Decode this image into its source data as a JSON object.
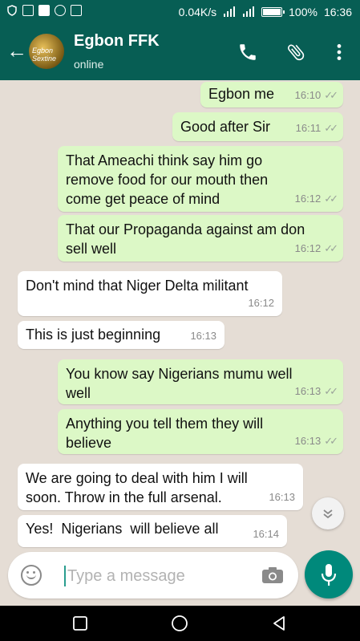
{
  "status_bar": {
    "speed": "0.04K/s",
    "battery": "100%",
    "time": "16:36",
    "icons": [
      "shield-icon",
      "true-badge-icon",
      "facebook-icon",
      "ball-icon",
      "screenshot-icon",
      "signal-icon",
      "4g-signal-icon",
      "battery-icon"
    ]
  },
  "header": {
    "name": "Egbon FFK",
    "status": "online",
    "avatar_text": "Egbon Sextine",
    "icons": [
      "back-arrow-icon",
      "phone-icon",
      "attach-icon",
      "more-vert-icon"
    ]
  },
  "messages": [
    {
      "dir": "out",
      "lines": [
        "Egbon me"
      ],
      "time": "16:10",
      "ticks": true
    },
    {
      "dir": "out",
      "lines": [
        "Good after Sir"
      ],
      "time": "16:11",
      "ticks": true
    },
    {
      "dir": "out",
      "lines": [
        "That Ameachi think say him go",
        "remove food for our mouth then",
        "come get peace of mind"
      ],
      "time": "16:12",
      "ticks": true
    },
    {
      "dir": "out",
      "lines": [
        "That our Propaganda against am don",
        "sell well"
      ],
      "time": "16:12",
      "ticks": true
    },
    {
      "dir": "in",
      "lines": [
        "Don't mind that Niger Delta militant"
      ],
      "time": "16:12"
    },
    {
      "dir": "in",
      "lines": [
        "This is just beginning"
      ],
      "time": "16:13"
    },
    {
      "dir": "out",
      "lines": [
        "You know say Nigerians mumu well",
        "well"
      ],
      "time": "16:13",
      "ticks": true
    },
    {
      "dir": "out",
      "lines": [
        "Anything you tell them they will",
        "believe"
      ],
      "time": "16:13",
      "ticks": true
    },
    {
      "dir": "in",
      "lines": [
        "We are going to deal with him I will",
        "soon. Throw in the full arsenal."
      ],
      "time": "16:13"
    },
    {
      "dir": "in",
      "lines": [
        "Yes!  Nigerians  will believe all"
      ],
      "time": "16:14"
    }
  ],
  "input": {
    "placeholder": "Type a message",
    "icons": [
      "emoji-icon",
      "camera-icon",
      "mic-icon"
    ]
  },
  "colors": {
    "header": "#075e54",
    "outgoing_bubble": "#dcf8c6",
    "incoming_bubble": "#ffffff",
    "mic_button": "#00897b",
    "chat_background": "#e5ddd5"
  },
  "nav_icons": [
    "recents-square-icon",
    "home-circle-icon",
    "back-triangle-icon"
  ]
}
